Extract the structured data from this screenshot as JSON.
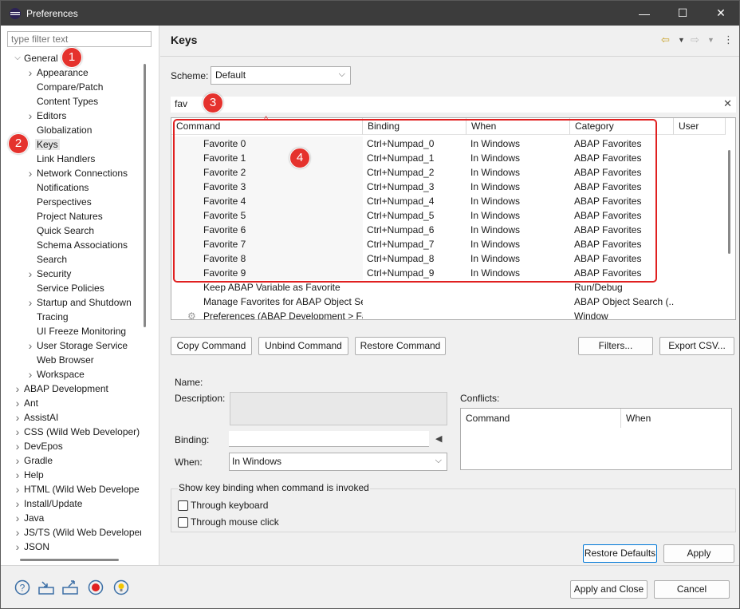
{
  "window": {
    "title": "Preferences",
    "minimize": "—",
    "maximize": "☐",
    "close": "✕"
  },
  "left": {
    "filter_placeholder": "type filter text",
    "tree": [
      {
        "label": "General",
        "toggle": "expanded",
        "level": 0
      },
      {
        "label": "Appearance",
        "toggle": "collapsed",
        "level": 1
      },
      {
        "label": "Compare/Patch",
        "toggle": "none",
        "level": 1
      },
      {
        "label": "Content Types",
        "toggle": "none",
        "level": 1
      },
      {
        "label": "Editors",
        "toggle": "collapsed",
        "level": 1
      },
      {
        "label": "Globalization",
        "toggle": "none",
        "level": 1
      },
      {
        "label": "Keys",
        "toggle": "none",
        "level": 1,
        "selected": true
      },
      {
        "label": "Link Handlers",
        "toggle": "none",
        "level": 1
      },
      {
        "label": "Network Connections",
        "toggle": "collapsed",
        "level": 1
      },
      {
        "label": "Notifications",
        "toggle": "none",
        "level": 1
      },
      {
        "label": "Perspectives",
        "toggle": "none",
        "level": 1
      },
      {
        "label": "Project Natures",
        "toggle": "none",
        "level": 1
      },
      {
        "label": "Quick Search",
        "toggle": "none",
        "level": 1
      },
      {
        "label": "Schema Associations",
        "toggle": "none",
        "level": 1
      },
      {
        "label": "Search",
        "toggle": "none",
        "level": 1
      },
      {
        "label": "Security",
        "toggle": "collapsed",
        "level": 1
      },
      {
        "label": "Service Policies",
        "toggle": "none",
        "level": 1
      },
      {
        "label": "Startup and Shutdown",
        "toggle": "collapsed",
        "level": 1
      },
      {
        "label": "Tracing",
        "toggle": "none",
        "level": 1
      },
      {
        "label": "UI Freeze Monitoring",
        "toggle": "none",
        "level": 1
      },
      {
        "label": "User Storage Service",
        "toggle": "collapsed",
        "level": 1
      },
      {
        "label": "Web Browser",
        "toggle": "none",
        "level": 1
      },
      {
        "label": "Workspace",
        "toggle": "collapsed",
        "level": 1
      },
      {
        "label": "ABAP Development",
        "toggle": "collapsed",
        "level": 0
      },
      {
        "label": "Ant",
        "toggle": "collapsed",
        "level": 0
      },
      {
        "label": "AssistAI",
        "toggle": "collapsed",
        "level": 0
      },
      {
        "label": "CSS (Wild Web Developer)",
        "toggle": "collapsed",
        "level": 0
      },
      {
        "label": "DevEpos",
        "toggle": "collapsed",
        "level": 0
      },
      {
        "label": "Gradle",
        "toggle": "collapsed",
        "level": 0
      },
      {
        "label": "Help",
        "toggle": "collapsed",
        "level": 0
      },
      {
        "label": "HTML (Wild Web Develope",
        "toggle": "collapsed",
        "level": 0
      },
      {
        "label": "Install/Update",
        "toggle": "collapsed",
        "level": 0
      },
      {
        "label": "Java",
        "toggle": "collapsed",
        "level": 0
      },
      {
        "label": "JS/TS (Wild Web Developer)",
        "toggle": "collapsed",
        "level": 0
      },
      {
        "label": "JSON",
        "toggle": "collapsed",
        "level": 0
      }
    ]
  },
  "main": {
    "title": "Keys",
    "scheme_label": "Scheme:",
    "scheme_value": "Default",
    "search_value": "fav",
    "columns": [
      "Command",
      "Binding",
      "When",
      "Category",
      "User"
    ],
    "rows": [
      {
        "command": "Favorite 0",
        "binding": "Ctrl+Numpad_0",
        "when": "In Windows",
        "category": "ABAP Favorites"
      },
      {
        "command": "Favorite 1",
        "binding": "Ctrl+Numpad_1",
        "when": "In Windows",
        "category": "ABAP Favorites"
      },
      {
        "command": "Favorite 2",
        "binding": "Ctrl+Numpad_2",
        "when": "In Windows",
        "category": "ABAP Favorites"
      },
      {
        "command": "Favorite 3",
        "binding": "Ctrl+Numpad_3",
        "when": "In Windows",
        "category": "ABAP Favorites"
      },
      {
        "command": "Favorite 4",
        "binding": "Ctrl+Numpad_4",
        "when": "In Windows",
        "category": "ABAP Favorites"
      },
      {
        "command": "Favorite 5",
        "binding": "Ctrl+Numpad_5",
        "when": "In Windows",
        "category": "ABAP Favorites"
      },
      {
        "command": "Favorite 6",
        "binding": "Ctrl+Numpad_6",
        "when": "In Windows",
        "category": "ABAP Favorites"
      },
      {
        "command": "Favorite 7",
        "binding": "Ctrl+Numpad_7",
        "when": "In Windows",
        "category": "ABAP Favorites"
      },
      {
        "command": "Favorite 8",
        "binding": "Ctrl+Numpad_8",
        "when": "In Windows",
        "category": "ABAP Favorites"
      },
      {
        "command": "Favorite 9",
        "binding": "Ctrl+Numpad_9",
        "when": "In Windows",
        "category": "ABAP Favorites"
      },
      {
        "command": "Keep ABAP Variable as Favorite",
        "binding": "",
        "when": "",
        "category": "Run/Debug"
      },
      {
        "command": "Manage Favorites for ABAP Object Sea",
        "binding": "",
        "when": "",
        "category": "ABAP Object Search (..."
      },
      {
        "command": "Preferences (ABAP Development > Fav",
        "binding": "",
        "when": "",
        "category": "Window",
        "icon": "gear-icon"
      }
    ],
    "buttons": {
      "copy": "Copy Command",
      "unbind": "Unbind Command",
      "restore": "Restore Command",
      "filters": "Filters...",
      "export": "Export CSV..."
    },
    "details": {
      "name_label": "Name:",
      "description_label": "Description:",
      "binding_label": "Binding:",
      "when_label": "When:",
      "when_value": "In Windows",
      "conflicts_label": "Conflicts:",
      "conflict_columns": [
        "Command",
        "When"
      ]
    },
    "show_group": {
      "label": "Show key binding when command is invoked",
      "through_keyboard": "Through keyboard",
      "through_mouse": "Through mouse click"
    },
    "restore_defaults": "Restore Defaults",
    "apply": "Apply"
  },
  "annotations": [
    "1",
    "2",
    "3",
    "4"
  ],
  "footer": {
    "apply_close": "Apply and Close",
    "cancel": "Cancel"
  },
  "colors": {
    "titlebar": "#3c3c3c",
    "annotation": "#e5322d",
    "accent": "#0078d7"
  }
}
